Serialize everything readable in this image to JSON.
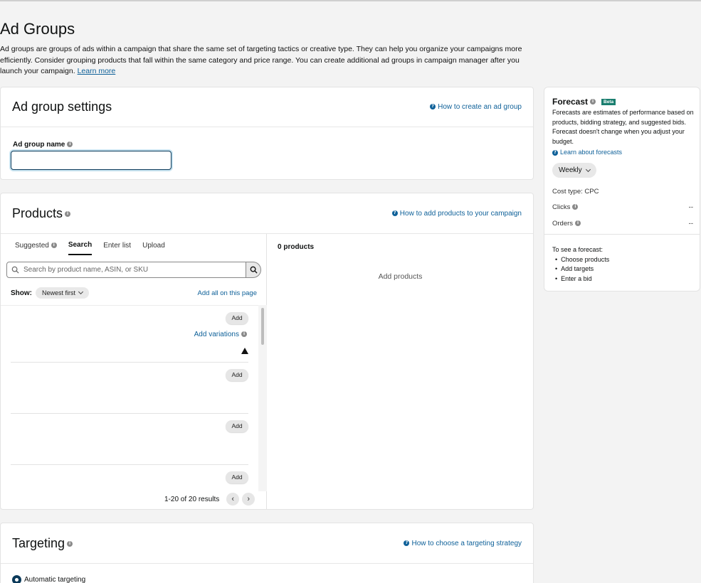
{
  "page": {
    "title": "Ad Groups",
    "description": "Ad groups are groups of ads within a campaign that share the same set of targeting tactics or creative type. They can help you organize your campaigns more efficiently. Consider grouping products that fall within the same category and price range. You can create additional ad groups in campaign manager after you launch your campaign.",
    "learn_more": "Learn more"
  },
  "settings": {
    "title": "Ad group settings",
    "help_link": "How to create an ad group",
    "name_label": "Ad group name",
    "name_value": ""
  },
  "products": {
    "title": "Products",
    "help_link": "How to add products to your campaign",
    "tabs": [
      "Suggested",
      "Search",
      "Enter list",
      "Upload"
    ],
    "active_tab": "Search",
    "search_placeholder": "Search by product name, ASIN, or SKU",
    "show_label": "Show:",
    "sort_value": "Newest first",
    "add_all": "Add all on this page",
    "add_label": "Add",
    "add_variations": "Add variations",
    "pagination": "1-20 of 20 results",
    "selected_count": "0 products",
    "empty_text": "Add products"
  },
  "targeting": {
    "title": "Targeting",
    "help_link": "How to choose a targeting strategy",
    "option": "Automatic targeting"
  },
  "forecast": {
    "title": "Forecast",
    "badge": "Beta",
    "description": "Forecasts are estimates of performance based on products, bidding strategy, and suggested bids. Forecast doesn't change when you adjust your budget.",
    "learn_link": "Learn about forecasts",
    "period": "Weekly",
    "cost_type": "Cost type: CPC",
    "clicks_label": "Clicks",
    "clicks_value": "--",
    "orders_label": "Orders",
    "orders_value": "--",
    "hint_title": "To see a forecast:",
    "hint_items": [
      "Choose products",
      "Add targets",
      "Enter a bid"
    ]
  }
}
